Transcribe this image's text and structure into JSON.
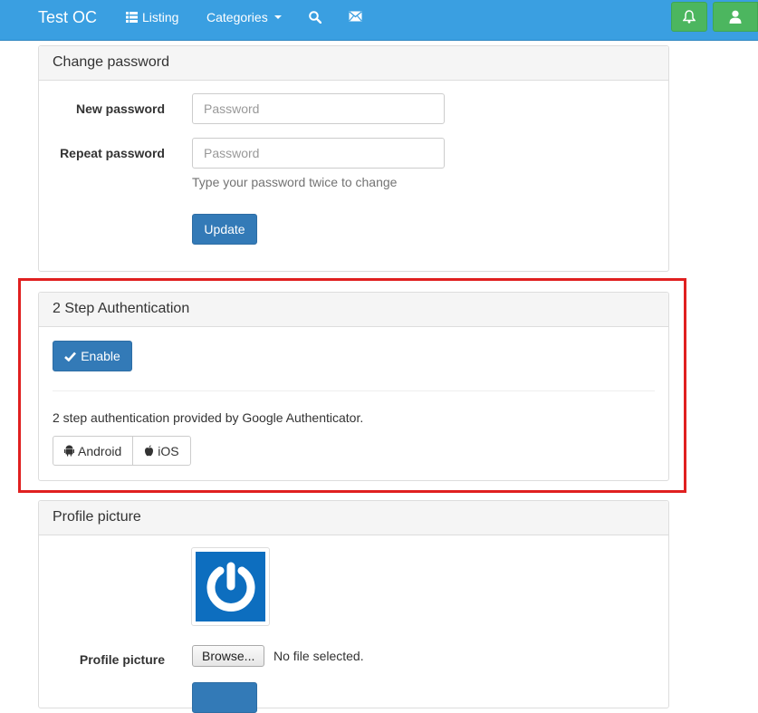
{
  "navbar": {
    "brand": "Test OC",
    "listing": "Listing",
    "categories": "Categories",
    "accent": "#3a9fe1",
    "green": "#4cb65f"
  },
  "change_password": {
    "heading": "Change password",
    "new_label": "New password",
    "new_placeholder": "Password",
    "repeat_label": "Repeat password",
    "repeat_placeholder": "Password",
    "help": "Type your password twice to change",
    "update_button": "Update"
  },
  "two_step": {
    "heading": "2 Step Authentication",
    "enable_button": "Enable",
    "description": "2 step authentication provided by Google Authenticator.",
    "android": "Android",
    "ios": "iOS"
  },
  "profile_picture": {
    "heading": "Profile picture",
    "label": "Profile picture",
    "browse_button": "Browse...",
    "file_status": "No file selected."
  },
  "icons": {
    "listing": "list-icon",
    "search": "search-icon",
    "mail": "envelope-icon",
    "bell": "bell-icon",
    "user": "user-icon",
    "check": "check-icon",
    "android": "android-icon",
    "apple": "apple-icon"
  }
}
